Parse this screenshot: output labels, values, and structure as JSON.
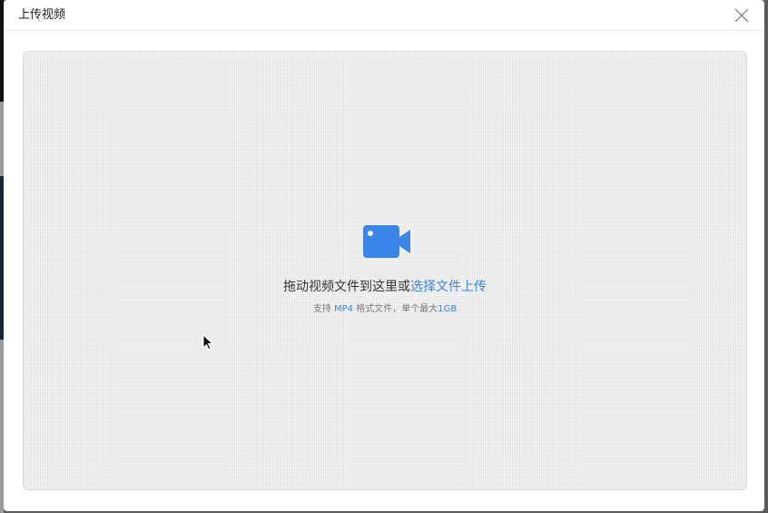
{
  "modal": {
    "title": "上传视频",
    "close_icon": "close-icon"
  },
  "dropzone": {
    "icon": "video-camera-icon",
    "drop_text": "拖动视频文件到这里或",
    "select_link": "选择文件上传",
    "hint_prefix": "支持 ",
    "hint_format": "MP4",
    "hint_middle": " 格式文件，单个最大",
    "hint_size": "1GB"
  },
  "colors": {
    "accent": "#3a86e8",
    "border": "#dcdcdc",
    "text": "#333333"
  }
}
